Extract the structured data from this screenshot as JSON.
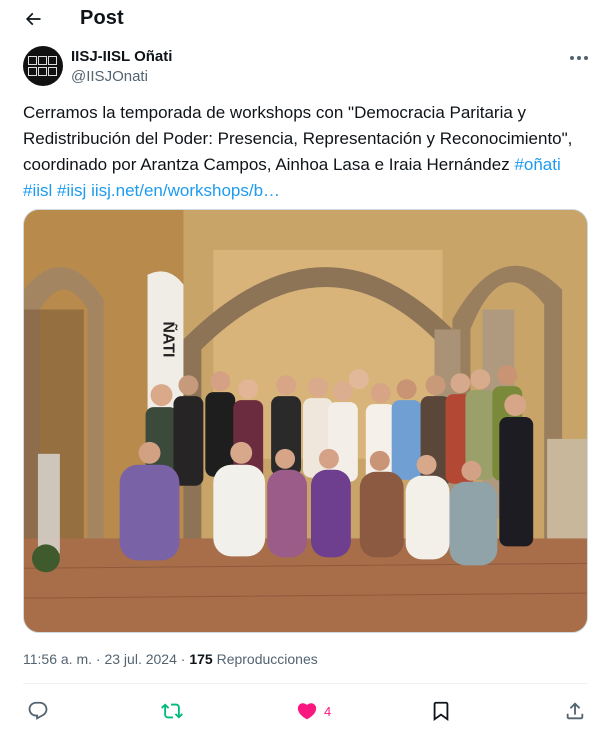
{
  "header": {
    "title": "Post",
    "back_icon": "arrow-left-icon"
  },
  "author": {
    "name": "IISJ-IISL Oñati",
    "handle": "@IISJOnati",
    "avatar_icon": "iisj-logo-icon"
  },
  "tweet": {
    "text_lead": "Cerramos la temporada de workshops con \"Democracia Paritaria y Redistribución del Poder: Presencia, Representación y Reconocimiento\", coordinado por Arantza Campos, Ainhoa Lasa e Iraia Hernández ",
    "hashtags": [
      "#oñati",
      "#iisl",
      "#iisj"
    ],
    "link": "iisj.net/en/workshops/b…"
  },
  "media": {
    "banner_text": "ÑATI"
  },
  "meta": {
    "time": "11:56 a. m.",
    "separator": " · ",
    "date": "23 jul. 2024",
    "views_count": "175",
    "views_label": " Reproducciones"
  },
  "actions": {
    "reply_icon": "reply-icon",
    "repost_icon": "repost-icon",
    "like_icon": "heart-icon",
    "like_count": "4",
    "bookmark_icon": "bookmark-icon",
    "share_icon": "share-icon"
  },
  "colors": {
    "link": "#1d9bf0",
    "secondary_text": "#536471",
    "like": "#f91880",
    "repost": "#00ba7c"
  }
}
